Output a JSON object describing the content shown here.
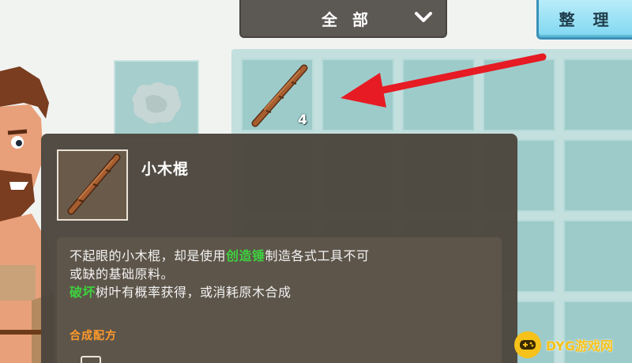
{
  "header": {
    "filter_label": "全 部",
    "sort_label": "整 理"
  },
  "inventory": {
    "slots": [
      {
        "item": "wooden-stick",
        "count": "4"
      }
    ]
  },
  "tooltip": {
    "item_name": "小木棍",
    "description": {
      "line1_prefix": "不起眼的小木棍，却是使用",
      "line1_highlight": "创造锤",
      "line1_suffix": "制造各式工具不可",
      "line2": "或缺的基础原料。",
      "line3_highlight": "破坏",
      "line3_suffix": "树叶有概率获得，或消耗原木合成"
    },
    "recipe_title": "合成配方"
  },
  "watermark": {
    "text": "DYG游戏网"
  },
  "colors": {
    "highlight_green": "#3ed03e",
    "recipe_orange": "#ff9a2c",
    "slot_teal": "#9dcbca",
    "sort_button_blue": "#7fd8f1"
  }
}
